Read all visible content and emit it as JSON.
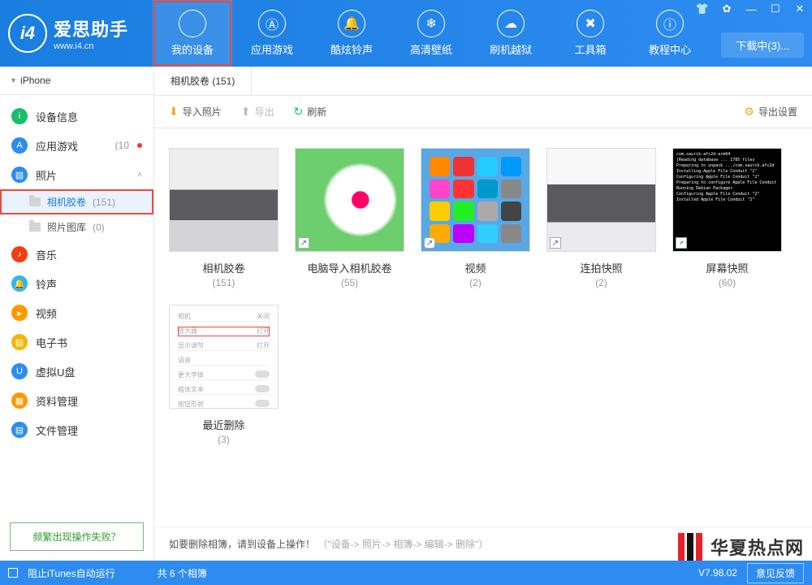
{
  "app": {
    "title": "爱思助手",
    "subtitle": "www.i4.cn",
    "logo_badge": "i4"
  },
  "nav": [
    {
      "label": "我的设备",
      "active": true,
      "highlighted": true
    },
    {
      "label": "应用游戏"
    },
    {
      "label": "酷炫铃声"
    },
    {
      "label": "高清壁纸"
    },
    {
      "label": "刷机越狱"
    },
    {
      "label": "工具箱"
    },
    {
      "label": "教程中心"
    }
  ],
  "download_btn": "下载中(3)...",
  "device_name": "iPhone",
  "sidebar": [
    {
      "key": "device-info",
      "label": "设备信息",
      "color": "#19be6b"
    },
    {
      "key": "apps",
      "label": "应用游戏",
      "count": "(10",
      "dot": true,
      "color": "#2d8cf0"
    },
    {
      "key": "photos",
      "label": "照片",
      "color": "#2d8cf0",
      "expanded": true,
      "children": [
        {
          "key": "camera-roll",
          "label": "相机胶卷",
          "count": "(151)",
          "selected": true,
          "highlighted": true
        },
        {
          "key": "photo-library",
          "label": "照片图库",
          "count": "(0)"
        }
      ]
    },
    {
      "key": "music",
      "label": "音乐",
      "color": "#ed4014"
    },
    {
      "key": "ringtones",
      "label": "铃声",
      "color": "#2db7f5"
    },
    {
      "key": "videos",
      "label": "视频",
      "color": "#ff9900"
    },
    {
      "key": "ebooks",
      "label": "电子书",
      "color": "#f7b500"
    },
    {
      "key": "udisk",
      "label": "虚拟U盘",
      "color": "#2d8cf0"
    },
    {
      "key": "data",
      "label": "资料管理",
      "color": "#ff9900"
    },
    {
      "key": "files",
      "label": "文件管理",
      "color": "#2d8cf0"
    }
  ],
  "help_link": "频繁出现操作失败？",
  "content": {
    "tab_label": "相机胶卷 (151)",
    "toolbar": {
      "import": "导入照片",
      "export": "导出",
      "refresh": "刷新",
      "settings": "导出设置"
    },
    "albums": [
      {
        "name": "相机胶卷",
        "count": "(151)",
        "thumb": "t1"
      },
      {
        "name": "电脑导入相机胶卷",
        "count": "(55)",
        "thumb": "t2",
        "shortcut": true
      },
      {
        "name": "视频",
        "count": "(2)",
        "thumb": "t3",
        "shortcut": true
      },
      {
        "name": "连拍快照",
        "count": "(2)",
        "thumb": "t4",
        "shortcut": true
      },
      {
        "name": "屏幕快照",
        "count": "(60)",
        "thumb": "t5",
        "shortcut": true
      },
      {
        "name": "最近删除",
        "count": "(3)",
        "thumb": "t6"
      }
    ],
    "hint_prefix": "如要删除相簿，请到设备上操作！",
    "hint_path": "（\"设备-> 照片-> 相簿-> 编辑-> 删除\"）"
  },
  "bottombar": {
    "itunes": "阻止iTunes自动运行",
    "summary": "共 6 个相簿",
    "version": "V7.98.02",
    "feedback": "意见反馈"
  },
  "watermark": "华夏热点网"
}
